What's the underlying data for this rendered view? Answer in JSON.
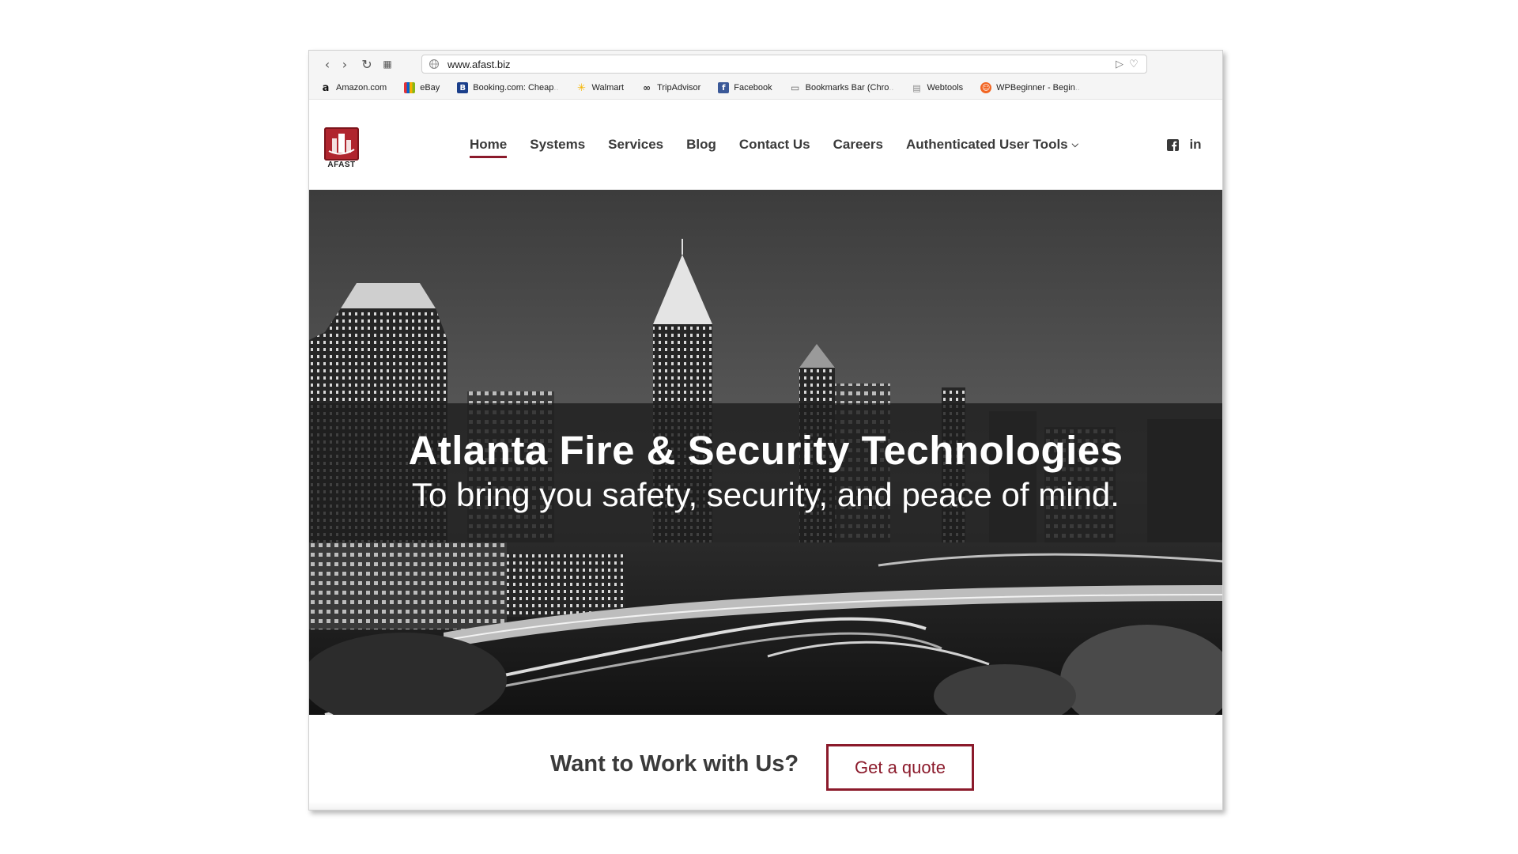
{
  "browser": {
    "url": "www.afast.biz",
    "bookmarks": [
      {
        "label": "Amazon.com",
        "icon": "amazon-icon"
      },
      {
        "label": "eBay",
        "icon": "ebay-icon"
      },
      {
        "label": "Booking.com: Cheap",
        "fade": "..",
        "icon": "booking-icon"
      },
      {
        "label": "Walmart",
        "icon": "walmart-icon"
      },
      {
        "label": "TripAdvisor",
        "icon": "tripadvisor-icon"
      },
      {
        "label": "Facebook",
        "icon": "facebook-icon"
      },
      {
        "label": "Bookmarks Bar (Chro",
        "fade": "..",
        "icon": "folder-icon"
      },
      {
        "label": "Webtools",
        "icon": "document-icon"
      },
      {
        "label": "WPBeginner - Begin",
        "fade": "..",
        "icon": "wpbeginner-icon"
      }
    ]
  },
  "site": {
    "logo_text": "AFAST",
    "nav": [
      {
        "label": "Home",
        "active": true
      },
      {
        "label": "Systems"
      },
      {
        "label": "Services"
      },
      {
        "label": "Blog"
      },
      {
        "label": "Contact Us"
      },
      {
        "label": "Careers"
      },
      {
        "label": "Authenticated User Tools",
        "has_dropdown": true
      }
    ],
    "social": [
      "facebook-icon",
      "linkedin-icon"
    ],
    "linkedin_text": "in"
  },
  "hero": {
    "title": "Atlanta Fire & Security Technologies",
    "subtitle": "To bring you safety, security, and peace of mind."
  },
  "cta": {
    "title": "Want to Work with Us?",
    "button": "Get a quote"
  },
  "colors": {
    "accent": "#8b1a2b",
    "logo_red": "#b0252e"
  }
}
